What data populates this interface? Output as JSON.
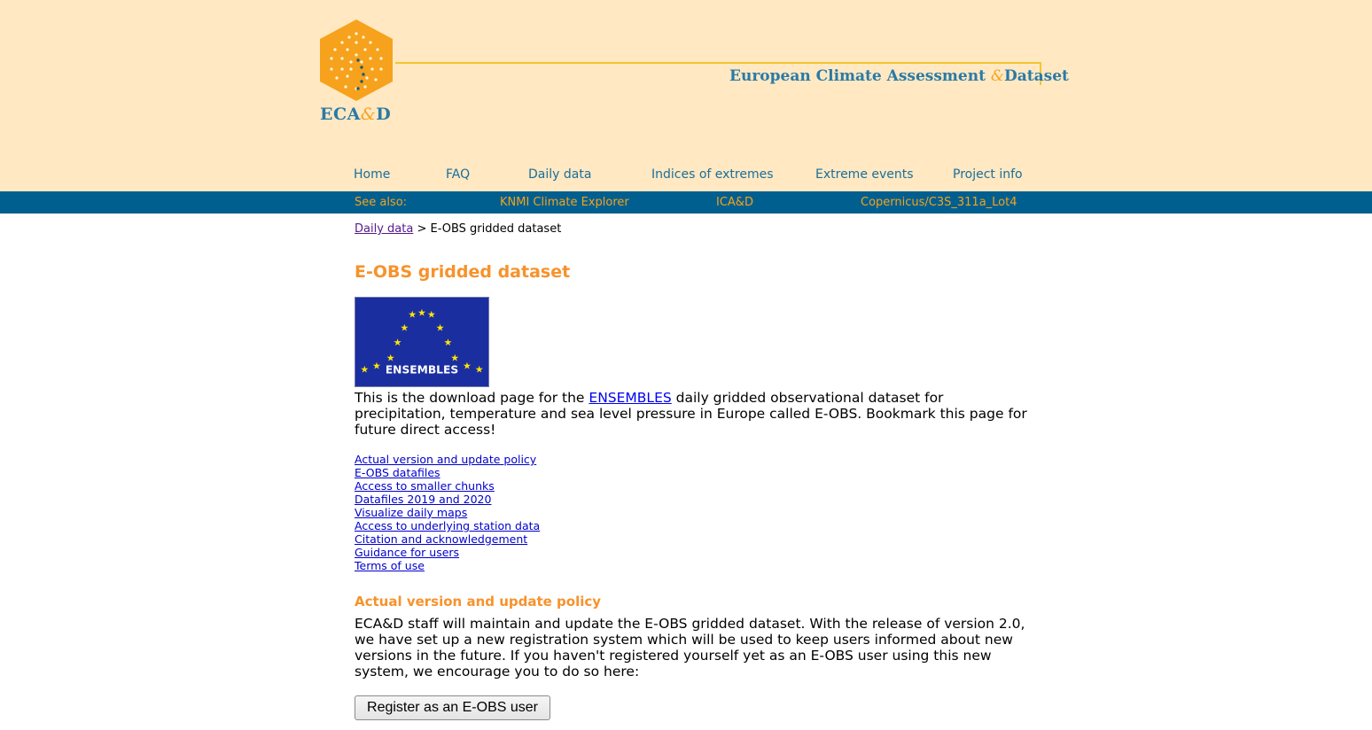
{
  "header": {
    "logo_text_pre": "ECA",
    "logo_text_amp": "&",
    "logo_text_post": "D",
    "site_title_pre": "European Climate Assessment ",
    "site_title_amp": "&",
    "site_title_post": "Dataset"
  },
  "nav": {
    "items": [
      {
        "label": "Home"
      },
      {
        "label": "FAQ"
      },
      {
        "label": "Daily data"
      },
      {
        "label": "Indices of extremes"
      },
      {
        "label": "Extreme events"
      },
      {
        "label": "Project info"
      }
    ]
  },
  "see_also": {
    "label": "See also:",
    "links": [
      {
        "label": "KNMI Climate Explorer"
      },
      {
        "label": "ICA&D"
      },
      {
        "label": "Copernicus/C3S_311a_Lot4"
      }
    ]
  },
  "breadcrumb": {
    "parent": "Daily data",
    "separator": " > ",
    "current": "E-OBS gridded dataset"
  },
  "main": {
    "title": "E-OBS gridded dataset",
    "image_label": "ENSEMBLES",
    "intro_before": "This is the download page for the ",
    "intro_link": "ENSEMBLES",
    "intro_after": " daily gridded observational dataset for precipitation, temperature and sea level pressure in Europe called E-OBS. Bookmark this page for future direct access!",
    "toc": [
      "Actual version and update policy",
      "E-OBS datafiles",
      "Access to smaller chunks",
      "Datafiles 2019 and 2020",
      "Visualize daily maps",
      "Access to underlying station data",
      "Citation and acknowledgement",
      "Guidance for users",
      "Terms of use"
    ],
    "section_title": "Actual version and update policy",
    "policy_text": "ECA&D staff will maintain and update the E-OBS gridded dataset. With the release of version 2.0, we have set up a new registration system which will be used to keep users informed about new versions in the future. If you haven't registered yourself yet as an E-OBS user using this new system, we encourage you to do so here:",
    "register_button": "Register as an E-OBS user"
  },
  "colors": {
    "header_bg": "#ffe8c2",
    "bar_bg": "#005f8f",
    "accent_orange": "#f7922b",
    "nav_blue": "#1a6e9a"
  }
}
